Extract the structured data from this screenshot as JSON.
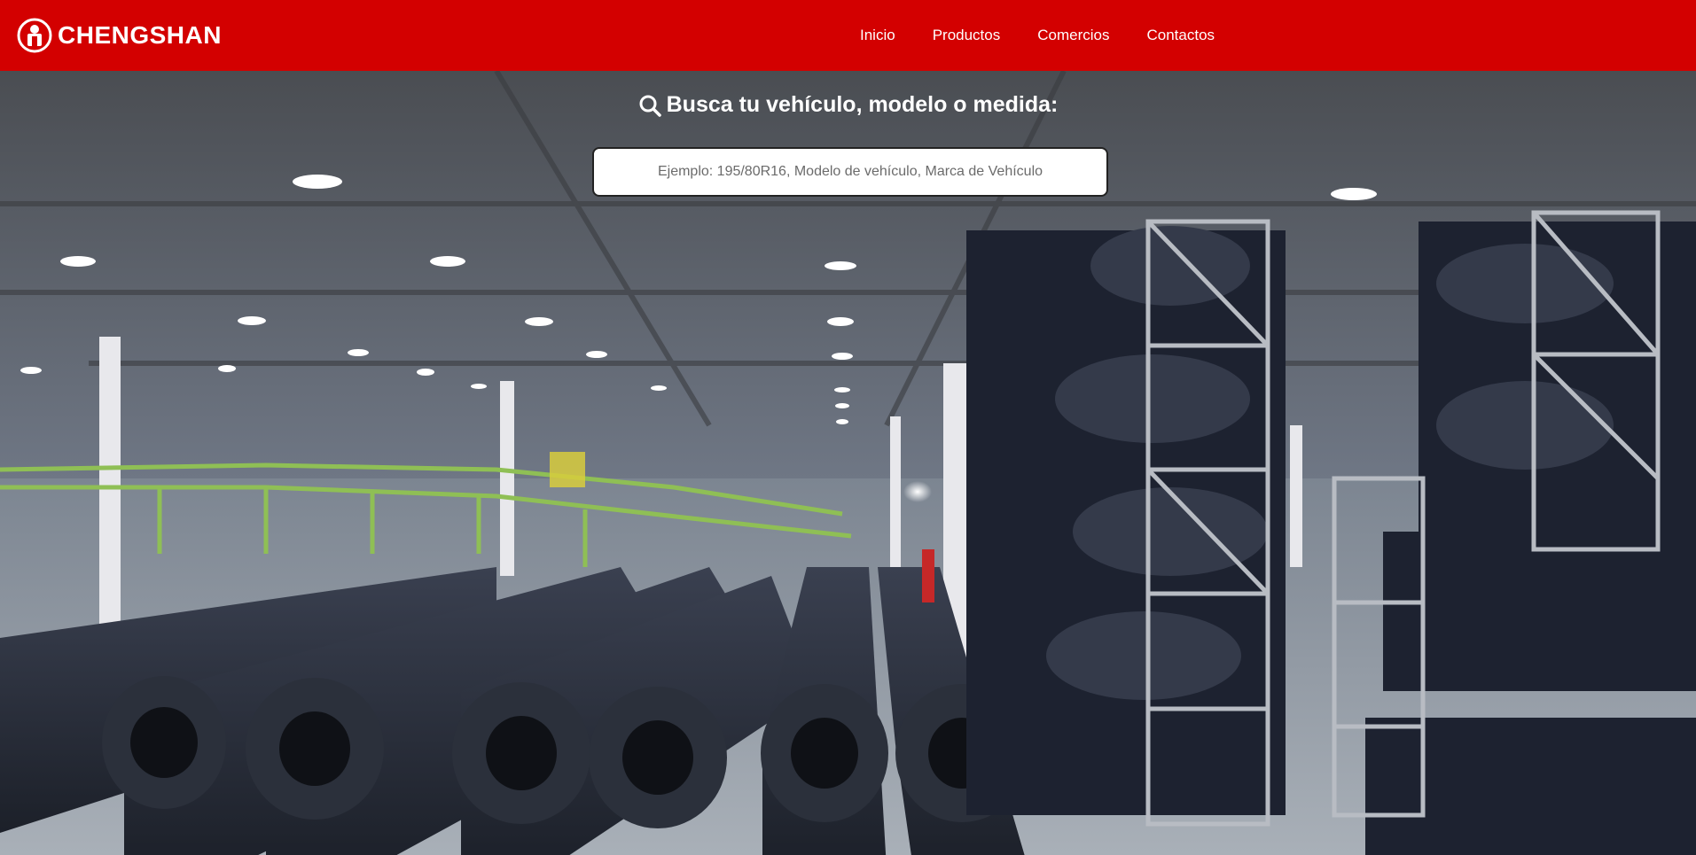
{
  "brand": {
    "name": "CHENGSHAN",
    "logo_icon": "chengshan-logo-icon"
  },
  "nav": {
    "items": [
      {
        "label": "Inicio"
      },
      {
        "label": "Productos"
      },
      {
        "label": "Comercios"
      },
      {
        "label": "Contactos"
      }
    ]
  },
  "hero": {
    "search_heading": "Busca tu vehículo, modelo o medida:",
    "search_icon": "search-icon",
    "search_placeholder": "Ejemplo: 195/80R16, Modelo de vehículo, Marca de Vehículo",
    "search_value": "",
    "background": "tire-warehouse-photo"
  },
  "colors": {
    "nav_background": "#d30000",
    "text_on_nav": "#ffffff"
  }
}
